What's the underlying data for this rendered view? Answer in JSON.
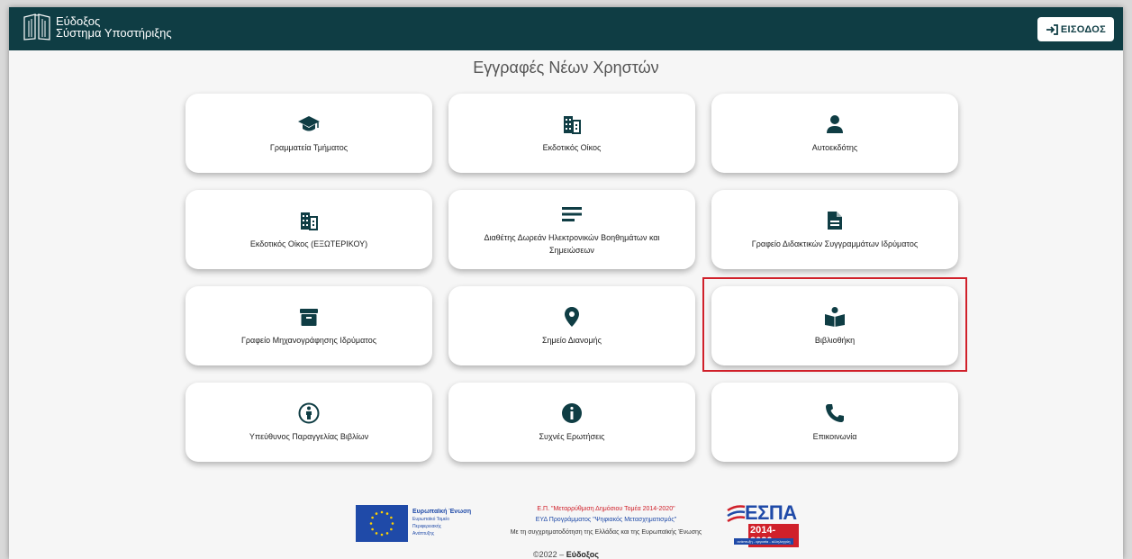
{
  "header": {
    "logo_line1": "Εύδοξος",
    "logo_line2": "Σύστημα Υποστήριξης",
    "login_label": "ΕΙΣΟΔΟΣ"
  },
  "title": "Εγγραφές Νέων Χρηστών",
  "cards": [
    {
      "label": "Γραμματεία Τμήματος",
      "icon": "graduation-cap-icon"
    },
    {
      "label": "Εκδοτικός Οίκος",
      "icon": "building-icon"
    },
    {
      "label": "Αυτοεκδότης",
      "icon": "person-icon"
    },
    {
      "label": "Εκδοτικός Οίκος (ΕΞΩΤΕΡΙΚΟΥ)",
      "icon": "building-icon"
    },
    {
      "label": "Διαθέτης Δωρεάν Ηλεκτρονικών Βοηθημάτων και Σημειώσεων",
      "icon": "notes-lines-icon"
    },
    {
      "label": "Γραφείο Διδακτικών Συγγραμμάτων Ιδρύματος",
      "icon": "document-icon"
    },
    {
      "label": "Γραφείο Μηχανογράφησης Ιδρύματος",
      "icon": "archive-box-icon"
    },
    {
      "label": "Σημείο Διανομής",
      "icon": "location-pin-icon"
    },
    {
      "label": "Βιβλιοθήκη",
      "icon": "reading-person-icon"
    },
    {
      "label": "Υπεύθυνος Παραγγελίας Βιβλίων",
      "icon": "accessibility-person-icon"
    },
    {
      "label": "Συχνές Ερωτήσεις",
      "icon": "info-icon"
    },
    {
      "label": "Επικοινωνία",
      "icon": "phone-icon"
    }
  ],
  "footer": {
    "eu_title": "Ευρωπαϊκή Ένωση",
    "eu_sub1": "Ευρωπαϊκό Ταμείο",
    "eu_sub2": "Περιφερειακής",
    "eu_sub3": "Ανάπτυξης",
    "ep_line1": "Ε.Π. \"Μεταρρύθμιση Δημόσιου Τομέα 2014-2020\"",
    "ep_line2": "ΕΥΔ Προγράμματος \"Ψηφιακός Μετασχηματισμός\"",
    "ep_line3": "Με τη συγχρηματοδότηση της Ελλάδας και της Ευρωπαϊκής Ένωσης",
    "espa_title": "ΕΣΠΑ",
    "espa_years": "2014-2020",
    "espa_tag": "ανάπτυξη - εργασία - αλληλεγγύη",
    "copyright_prefix": "©2022 –",
    "copyright_name": "Εύδοξος"
  },
  "colors": {
    "header_bg": "#0f3d44",
    "icon_color": "#0f3d44",
    "highlight": "#d0202a"
  }
}
